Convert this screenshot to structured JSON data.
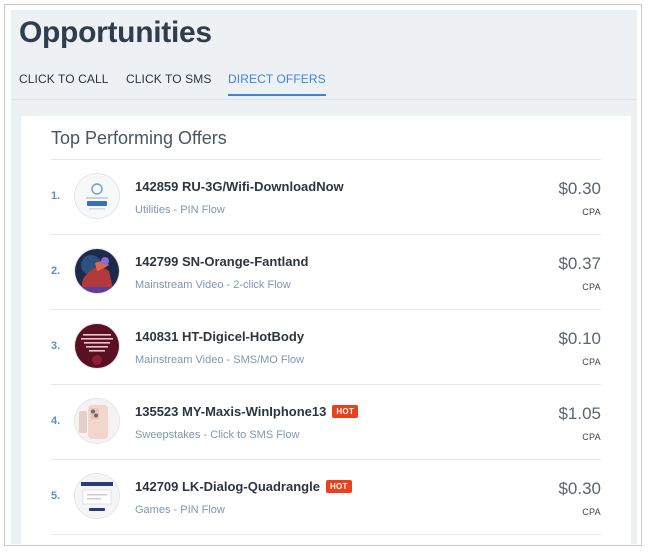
{
  "page": {
    "title": "Opportunities"
  },
  "tabs": [
    {
      "label": "CLICK TO CALL",
      "active": false
    },
    {
      "label": "CLICK TO SMS",
      "active": false
    },
    {
      "label": "DIRECT OFFERS",
      "active": true
    }
  ],
  "card": {
    "title": "Top Performing Offers"
  },
  "offers": [
    {
      "rank": "1.",
      "name": "142859 RU-3G/Wifi-DownloadNow",
      "hot": false,
      "category": "Utilities - PIN Flow",
      "price": "$0.30",
      "unit": "CPA",
      "thumb_icon": "download-app-thumbnail"
    },
    {
      "rank": "2.",
      "name": "142799 SN-Orange-Fantland",
      "hot": false,
      "category": "Mainstream Video - 2-click Flow",
      "price": "$0.37",
      "unit": "CPA",
      "thumb_icon": "fantasy-video-thumbnail"
    },
    {
      "rank": "3.",
      "name": "140831 HT-Digicel-HotBody",
      "hot": false,
      "category": "Mainstream Video - SMS/MO Flow",
      "price": "$0.10",
      "unit": "CPA",
      "thumb_icon": "fitness-video-thumbnail"
    },
    {
      "rank": "4.",
      "name": "135523 MY-Maxis-WinIphone13",
      "hot": true,
      "hot_label": "HOT",
      "category": "Sweepstakes - Click to SMS Flow",
      "price": "$1.05",
      "unit": "CPA",
      "thumb_icon": "iphone-thumbnail"
    },
    {
      "rank": "5.",
      "name": "142709 LK-Dialog-Quadrangle",
      "hot": true,
      "hot_label": "HOT",
      "category": "Games - PIN Flow",
      "price": "$0.30",
      "unit": "CPA",
      "thumb_icon": "game-page-thumbnail"
    }
  ],
  "colors": {
    "active_tab": "#3d86d6",
    "hot_badge": "#e8411c",
    "title": "#2f3d4e",
    "subtitle": "#7f97b3"
  }
}
